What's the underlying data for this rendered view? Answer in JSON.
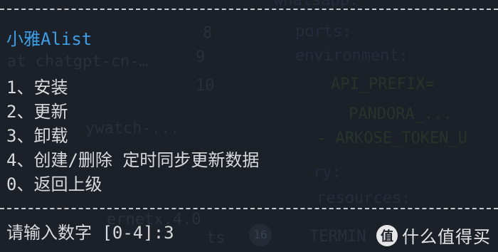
{
  "menu": {
    "title": "小雅Alist",
    "items": [
      {
        "label": "1、安装"
      },
      {
        "label": "2、更新"
      },
      {
        "label": "3、卸载"
      },
      {
        "label": "4、创建/删除 定时同步更新数据"
      },
      {
        "label": "0、返回上级"
      }
    ]
  },
  "prompt": {
    "text": "请输入数字 [0-4]:3"
  },
  "background_editor": {
    "lines": [
      "ports:",
      "environment:",
      "- ARKOSE_TOKEN_U",
      "resources:"
    ],
    "ghost_fragments": [
      "at chatgpt-cn-…",
      "8",
      "9",
      "10",
      "ry:",
      "TERMIN",
      "ts",
      "16"
    ]
  },
  "watermark": {
    "text": "值 什么值得买",
    "icon": "zhi-logo-icon"
  }
}
